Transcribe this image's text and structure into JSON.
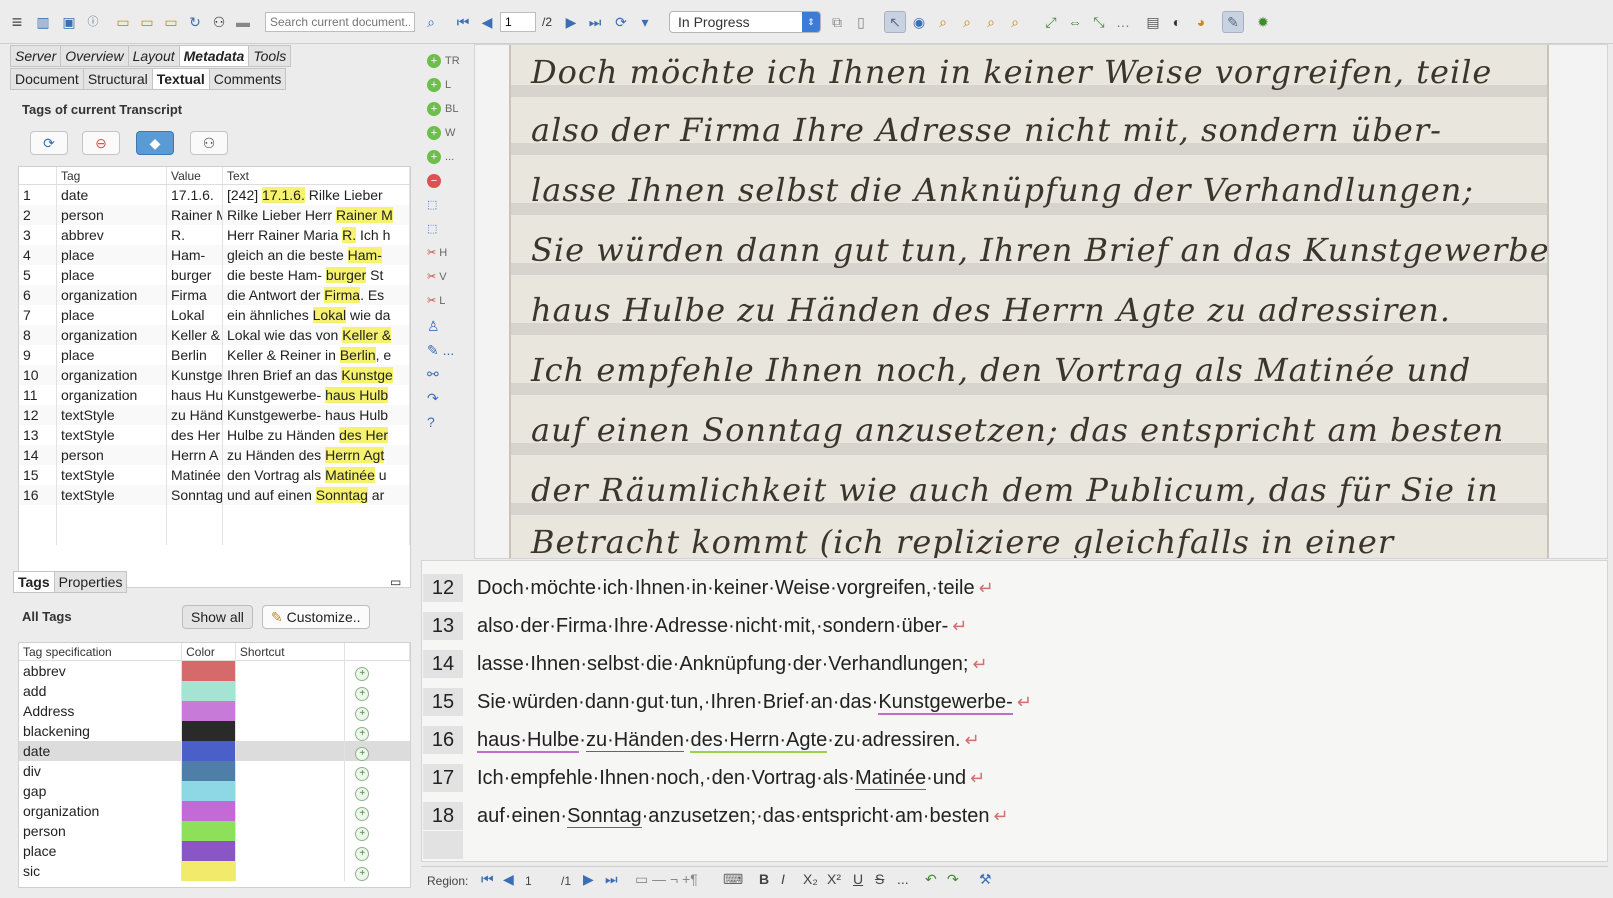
{
  "toolbar": {
    "search_placeholder": "Search current document...",
    "page": "1",
    "page_total": "/2",
    "status": "In Progress"
  },
  "left": {
    "tabs_top": [
      "Server",
      "Overview",
      "Layout",
      "Metadata",
      "Tools"
    ],
    "tabs_sub": [
      "Document",
      "Structural",
      "Textual",
      "Comments"
    ],
    "section_title": "Tags of current Transcript",
    "tag_table": {
      "headers": [
        "Tag",
        "Value",
        "Text"
      ],
      "rows": [
        {
          "n": "1",
          "tag": "date",
          "value": "17.1.6.",
          "pre": "[242] ",
          "hl": "17.1.6.",
          "post": " Rilke Lieber"
        },
        {
          "n": "2",
          "tag": "person",
          "value": "Rainer M",
          "pre": "Rilke Lieber Herr ",
          "hl": "Rainer M",
          "post": ""
        },
        {
          "n": "3",
          "tag": "abbrev",
          "value": "R.",
          "pre": "Herr Rainer Maria ",
          "hl": "R.",
          "post": " Ich h"
        },
        {
          "n": "4",
          "tag": "place",
          "value": "Ham-",
          "pre": "gleich an die beste ",
          "hl": "Ham-",
          "post": ""
        },
        {
          "n": "5",
          "tag": "place",
          "value": "burger",
          "pre": "die beste Ham- ",
          "hl": "burger",
          "post": " St"
        },
        {
          "n": "6",
          "tag": "organization",
          "value": "Firma",
          "pre": "die Antwort der ",
          "hl": "Firma",
          "post": ". Es"
        },
        {
          "n": "7",
          "tag": "place",
          "value": "Lokal",
          "pre": "ein ähnliches ",
          "hl": "Lokal",
          "post": " wie da"
        },
        {
          "n": "8",
          "tag": "organization",
          "value": "Keller &",
          "pre": "Lokal wie das von ",
          "hl": "Keller &",
          "post": ""
        },
        {
          "n": "9",
          "tag": "place",
          "value": "Berlin",
          "pre": "Keller & Reiner in ",
          "hl": "Berlin",
          "post": ", e"
        },
        {
          "n": "10",
          "tag": "organization",
          "value": "Kunstge",
          "pre": "Ihren Brief an das ",
          "hl": "Kunstge",
          "post": ""
        },
        {
          "n": "11",
          "tag": "organization",
          "value": "haus Hu",
          "pre": "Kunstgewerbe- ",
          "hl": "haus Hulb",
          "post": ""
        },
        {
          "n": "12",
          "tag": "textStyle",
          "value": "zu Händ",
          "pre": "Kunstgewerbe- haus Hulb",
          "hl": "",
          "post": ""
        },
        {
          "n": "13",
          "tag": "textStyle",
          "value": "des Her",
          "pre": "Hulbe zu Händen ",
          "hl": "des Her",
          "post": ""
        },
        {
          "n": "14",
          "tag": "person",
          "value": "Herrn A",
          "pre": "zu Händen des ",
          "hl": "Herrn Agt",
          "post": ""
        },
        {
          "n": "15",
          "tag": "textStyle",
          "value": "Matinée",
          "pre": "den Vortrag als ",
          "hl": "Matinée",
          "post": " u"
        },
        {
          "n": "16",
          "tag": "textStyle",
          "value": "Sonntag",
          "pre": "und  auf einen ",
          "hl": "Sonntag",
          "post": " ar"
        }
      ]
    },
    "tabs_bottom": [
      "Tags",
      "Properties"
    ],
    "all_tags_label": "All Tags",
    "show_all": "Show all",
    "customize": "Customize..",
    "spec_table": {
      "headers": [
        "Tag specification",
        "Color",
        "Shortcut"
      ],
      "rows": [
        {
          "name": "abbrev",
          "color": "#d46a6a"
        },
        {
          "name": "add",
          "color": "#a5e3d2"
        },
        {
          "name": "Address",
          "color": "#c77ad8"
        },
        {
          "name": "blackening",
          "color": "#2a2a2a"
        },
        {
          "name": "date",
          "color": "#4a5fc8"
        },
        {
          "name": "div",
          "color": "#4f7fa8"
        },
        {
          "name": "gap",
          "color": "#8ed8e6"
        },
        {
          "name": "organization",
          "color": "#c46ad6"
        },
        {
          "name": "person",
          "color": "#8ee05a"
        },
        {
          "name": "place",
          "color": "#8a55c4"
        },
        {
          "name": "sic",
          "color": "#f2ea6a"
        }
      ]
    }
  },
  "vertical_tools": [
    "TR",
    "L",
    "BL",
    "W",
    "...",
    "H",
    "V",
    "L",
    "..."
  ],
  "transcript": [
    {
      "n": "12",
      "parts": [
        {
          "t": "Doch·möchte·ich·Ihnen·in·keiner·Weise·vorgreifen,·teile"
        }
      ]
    },
    {
      "n": "13",
      "parts": [
        {
          "t": "also·der·Firma·Ihre·Adresse·nicht·mit,·sondern·über-"
        }
      ]
    },
    {
      "n": "14",
      "parts": [
        {
          "t": "lasse·Ihnen·selbst·die·Anknüpfung·der·Verhandlungen;"
        }
      ]
    },
    {
      "n": "15",
      "parts": [
        {
          "t": "Sie·würden·dann·gut·tun,·Ihren·Brief·an·das·"
        },
        {
          "t": "Kunstgewerbe-",
          "u": "u1"
        }
      ]
    },
    {
      "n": "16",
      "parts": [
        {
          "t": "haus·Hulbe",
          "u": "u1"
        },
        {
          "t": "·"
        },
        {
          "t": "zu·Händen",
          "u": "u2"
        },
        {
          "t": "·"
        },
        {
          "t": "des·Herrn·Agte",
          "u": "u3"
        },
        {
          "t": "·zu·adressiren."
        }
      ]
    },
    {
      "n": "17",
      "parts": [
        {
          "t": "Ich·empfehle·Ihnen·noch,·den·Vortrag·als·"
        },
        {
          "t": "Matinée",
          "u": "u2"
        },
        {
          "t": "·und"
        }
      ]
    },
    {
      "n": "18",
      "parts": [
        {
          "t": "auf·einen·"
        },
        {
          "t": "Sonntag",
          "u": "u2"
        },
        {
          "t": "·anzusetzen;·das·entspricht·am·besten"
        }
      ]
    }
  ],
  "bottom": {
    "region_label": "Region:",
    "page": "1",
    "page_total": "/1",
    "fmt": [
      "B",
      "I",
      "X₂",
      "X²",
      "U",
      "S",
      "..."
    ]
  }
}
